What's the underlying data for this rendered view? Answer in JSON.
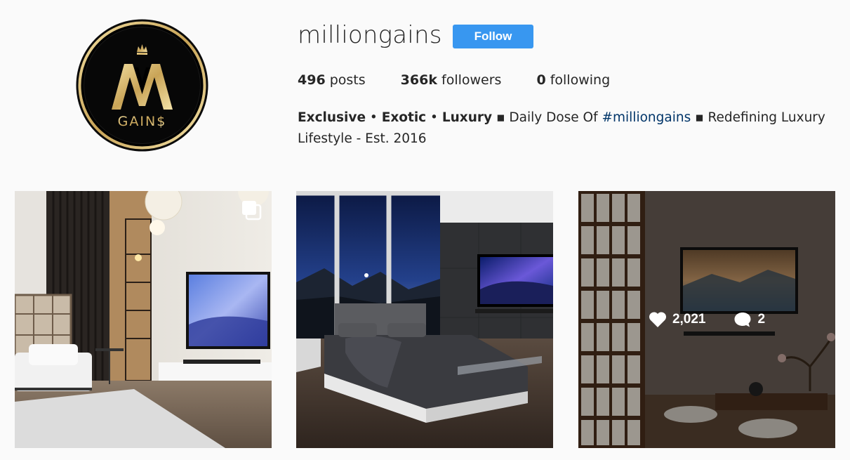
{
  "profile": {
    "username": "milliongains",
    "follow_label": "Follow",
    "avatar": {
      "monogram": "M",
      "wordmark": "GAIN$",
      "icon": "crown-icon"
    }
  },
  "stats": {
    "posts_count": "496",
    "posts_label": "posts",
    "followers_count": "366k",
    "followers_label": "followers",
    "following_count": "0",
    "following_label": "following"
  },
  "bio": {
    "tag1": "Exclusive",
    "sep1": " • ",
    "tag2": "Exotic",
    "sep2": " • ",
    "tag3": "Luxury",
    "text1": " ▪ Daily Dose Of ",
    "hashtag": "#milliongains",
    "text2": " ▪ Redefining Luxury Lifestyle - Est. 2016"
  },
  "posts": [
    {
      "icon": "multiple-images-icon"
    },
    {},
    {
      "likes": "2,021",
      "comments": "2",
      "like_icon": "heart-icon",
      "comment_icon": "comment-bubble-icon"
    }
  ],
  "colors": {
    "accent": "#3897f0",
    "background": "#fafafa",
    "text": "#262626",
    "hashtag": "#003569",
    "gold": "#d4b66a"
  }
}
